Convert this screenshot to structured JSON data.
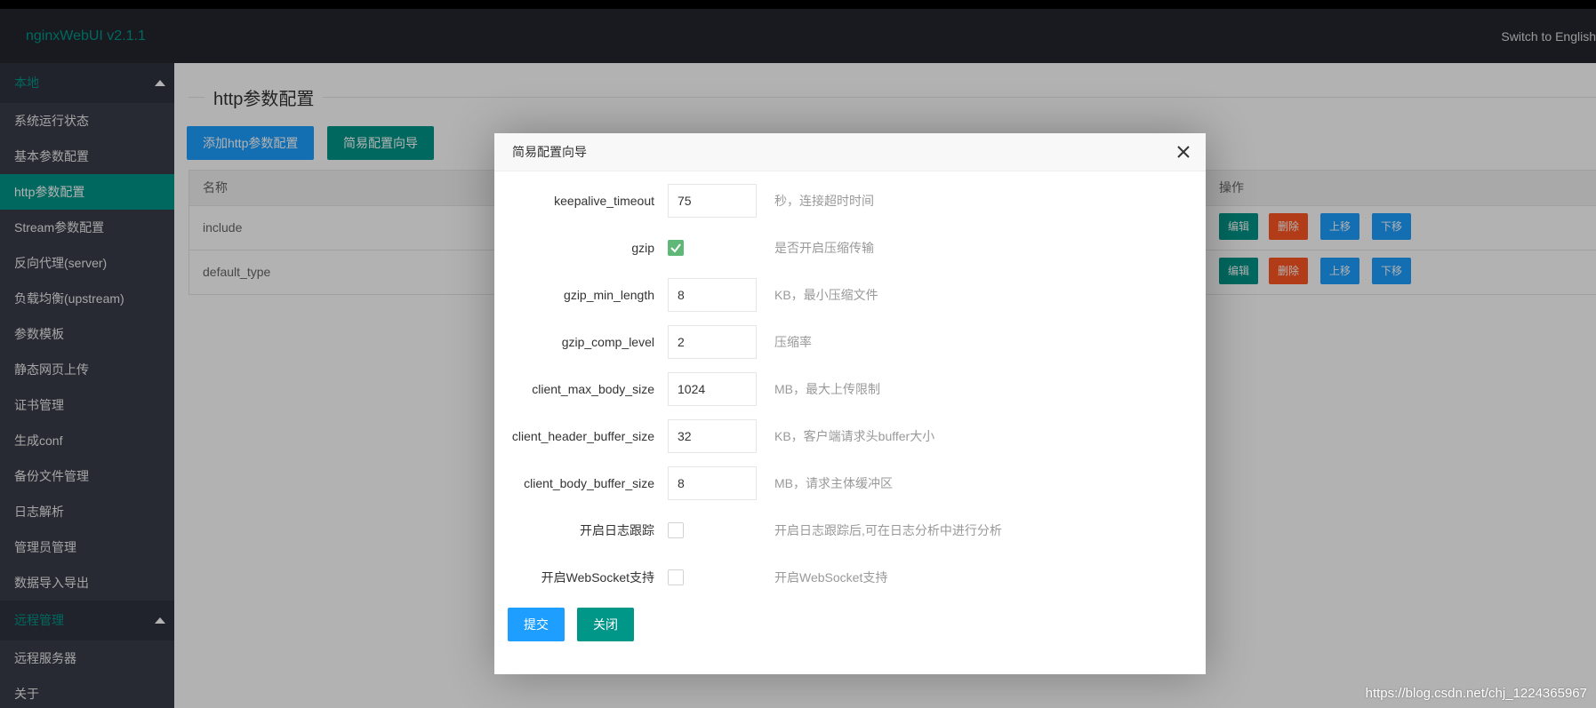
{
  "header": {
    "logo": "nginxWebUI v2.1.1",
    "lang_switch": "Switch to English"
  },
  "sidebar": {
    "group_local": "本地",
    "items": [
      "系统运行状态",
      "基本参数配置",
      "http参数配置",
      "Stream参数配置",
      "反向代理(server)",
      "负载均衡(upstream)",
      "参数模板",
      "静态网页上传",
      "证书管理",
      "生成conf",
      "备份文件管理",
      "日志解析",
      "管理员管理",
      "数据导入导出"
    ],
    "group_remote": "远程管理",
    "remote_items": [
      "远程服务器",
      "关于"
    ]
  },
  "main": {
    "title": "http参数配置",
    "add_button": "添加http参数配置",
    "wizard_button": "简易配置向导",
    "table": {
      "col_name": "名称",
      "col_ops": "操作",
      "rows": [
        {
          "name": "include"
        },
        {
          "name": "default_type"
        }
      ],
      "btn_edit": "编辑",
      "btn_delete": "删除",
      "btn_up": "上移",
      "btn_down": "下移"
    }
  },
  "modal": {
    "title": "简易配置向导",
    "fields": [
      {
        "label": "keepalive_timeout",
        "value": "75",
        "hint": "秒，连接超时时间"
      },
      {
        "label": "gzip",
        "checked": true,
        "hint": "是否开启压缩传输"
      },
      {
        "label": "gzip_min_length",
        "value": "8",
        "hint": "KB，最小压缩文件"
      },
      {
        "label": "gzip_comp_level",
        "value": "2",
        "hint": "压缩率"
      },
      {
        "label": "client_max_body_size",
        "value": "1024",
        "hint": "MB，最大上传限制"
      },
      {
        "label": "client_header_buffer_size",
        "value": "32",
        "hint": "KB，客户端请求头buffer大小"
      },
      {
        "label": "client_body_buffer_size",
        "value": "8",
        "hint": "MB，请求主体缓冲区"
      },
      {
        "label": "开启日志跟踪",
        "checked": false,
        "hint": "开启日志跟踪后,可在日志分析中进行分析"
      },
      {
        "label": "开启WebSocket支持",
        "checked": false,
        "hint": "开启WebSocket支持"
      }
    ],
    "submit": "提交",
    "close": "关闭"
  },
  "watermark": "https://blog.csdn.net/chj_1224365967",
  "colors": {
    "primary_green": "#009688",
    "primary_blue": "#1e9fff",
    "danger": "#ff5722",
    "check_green": "#5fb878"
  }
}
